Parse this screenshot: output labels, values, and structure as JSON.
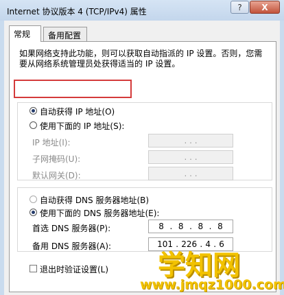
{
  "window": {
    "title": "Internet 协议版本 4 (TCP/IPv4) 属性",
    "help_label": "?",
    "close_label": "X"
  },
  "tabs": [
    {
      "label": "常规"
    },
    {
      "label": "备用配置"
    }
  ],
  "description": "如果网络支持此功能，则可以获取自动指派的 IP 设置。否则，您需要从网络系统管理员处获得适当的 IP 设置。",
  "ip": {
    "auto_label": "自动获得 IP 地址(O)",
    "manual_label": "使用下面的 IP 地址(S):",
    "auto_selected": true,
    "fields": [
      {
        "label": "IP 地址(I):",
        "value": ". . ."
      },
      {
        "label": "子网掩码(U):",
        "value": ". . ."
      },
      {
        "label": "默认网关(D):",
        "value": ". . ."
      }
    ]
  },
  "dns": {
    "auto_label": "自动获得 DNS 服务器地址(B)",
    "manual_label": "使用下面的 DNS 服务器地址(E):",
    "manual_selected": true,
    "preferred": {
      "label": "首选 DNS 服务器(P):",
      "octets": [
        "8",
        "8",
        "8",
        "8"
      ]
    },
    "alternate": {
      "label": "备用 DNS 服务器(A):",
      "octets": [
        "101",
        "226",
        "4",
        "6"
      ]
    }
  },
  "validate": {
    "label": "退出时验证设置(L)",
    "checked": false
  },
  "watermark": {
    "text": "学知网",
    "url": "www.jmqz1000.com"
  },
  "colors": {
    "highlight": "#d43a3a",
    "watermark": "#f2c200"
  }
}
